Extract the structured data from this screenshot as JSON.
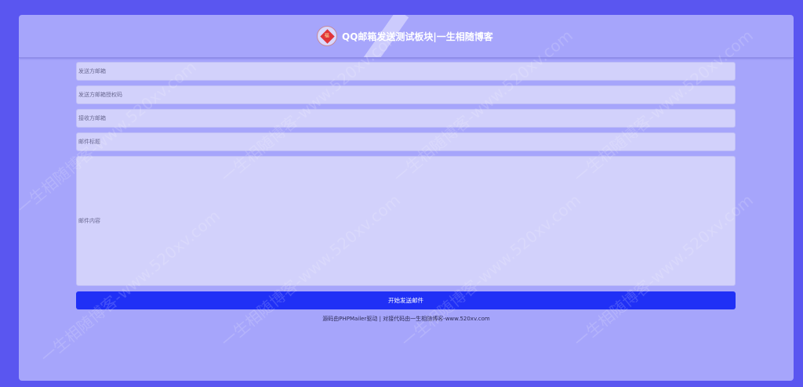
{
  "header": {
    "title": "QQ邮箱发送测试板块|一生相随博客",
    "logo_icon": "seal-diamond-icon",
    "logo_glyph": "福"
  },
  "form": {
    "sender_email_placeholder": "发送方邮箱",
    "sender_auth_code_placeholder": "发送方邮箱授权码",
    "recipient_email_placeholder": "接收方邮箱",
    "subject_placeholder": "邮件标题",
    "content_placeholder": "邮件内容",
    "send_button_label": "开始发送邮件"
  },
  "footer": {
    "text": "源码由PHPMailer驱动 | 对接代码由一生相随博客-www.520xv.com"
  },
  "watermark": {
    "text": "一生相随博客-www.520xv.com"
  },
  "colors": {
    "page_background": "#5a56f0",
    "card_background": "#a6a5fb",
    "field_background": "#d2d1fb",
    "button_background": "#2030f6",
    "title_color": "#ffffff"
  }
}
